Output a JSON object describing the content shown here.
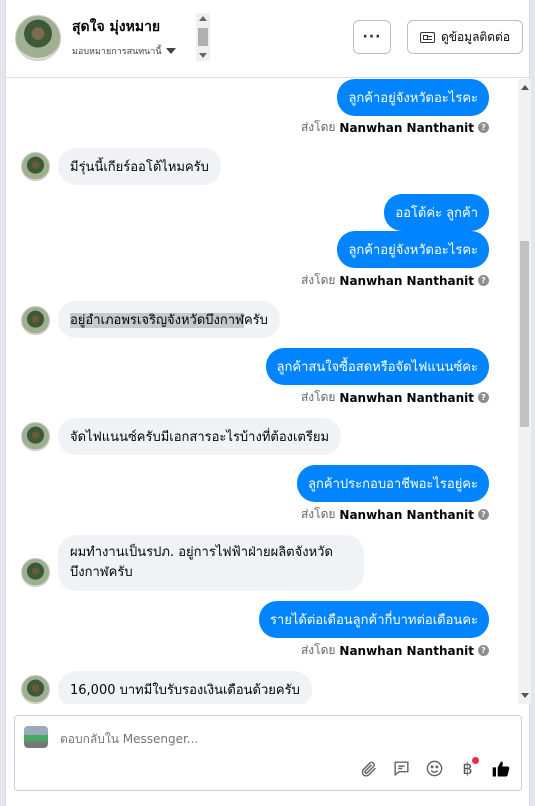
{
  "header": {
    "name": "สุดใจ มุ่งหมาย",
    "assign_label": "มอบหมายการสนทนานี้",
    "more_label": "···",
    "info_label": "ดูข้อมูลติดต่อ"
  },
  "messages": [
    {
      "dir": "out",
      "text": "ลูกค้าอยู่จังหวัดอะไรคะ"
    },
    {
      "dir": "meta",
      "prefix": "ส่งโดย",
      "agent": "Nanwhan Nanthanit"
    },
    {
      "dir": "in",
      "text": "มีรุ่นนี้เกียร์ออโต้ไหมครับ"
    },
    {
      "dir": "out",
      "text": "ออโต้ค่ะ ลูกค้า"
    },
    {
      "dir": "out",
      "text": "ลูกค้าอยู่จังหวัดอะไรคะ"
    },
    {
      "dir": "meta",
      "prefix": "ส่งโดย",
      "agent": "Nanwhan Nanthanit"
    },
    {
      "dir": "in",
      "text_highlight": "อยู่อำเภอพรเจริญจังหวัดบึงกาฬ",
      "text_rest": "ครับ"
    },
    {
      "dir": "out",
      "text": "ลูกค้าสนใจซื้อสดหรือจัดไฟแนนซ์คะ"
    },
    {
      "dir": "meta",
      "prefix": "ส่งโดย",
      "agent": "Nanwhan Nanthanit"
    },
    {
      "dir": "in",
      "text": "จัดไฟแนนซ์ครับมีเอกสารอะไรบ้างที่ต้องเตรียม"
    },
    {
      "dir": "out",
      "text": "ลูกค้าประกอบอาชีพอะไรอยู่คะ"
    },
    {
      "dir": "meta",
      "prefix": "ส่งโดย",
      "agent": "Nanwhan Nanthanit"
    },
    {
      "dir": "in",
      "text": "ผมทำงานเป็นรปภ. อยู่การไฟฟ้าฝ่ายผลิตจังหวัดบึงกาฬครับ"
    },
    {
      "dir": "out",
      "text": "รายได้ต่อเดือนลูกค้ากี่บาทต่อเดือนคะ"
    },
    {
      "dir": "meta",
      "prefix": "ส่งโดย",
      "agent": "Nanwhan Nanthanit"
    },
    {
      "dir": "in",
      "text": "16,000 บาทมีใบรับรองเงินเดือนด้วยครับ"
    }
  ],
  "composer": {
    "placeholder": "ตอบกลับใน Messenger..."
  },
  "colors": {
    "outgoing_bubble": "#0084ff",
    "incoming_bubble": "#f0f2f5",
    "notification_dot": "#f02849"
  },
  "icons": [
    "attachment-icon",
    "saved-reply-icon",
    "emoji-icon",
    "payment-icon",
    "like-icon",
    "help-icon"
  ]
}
